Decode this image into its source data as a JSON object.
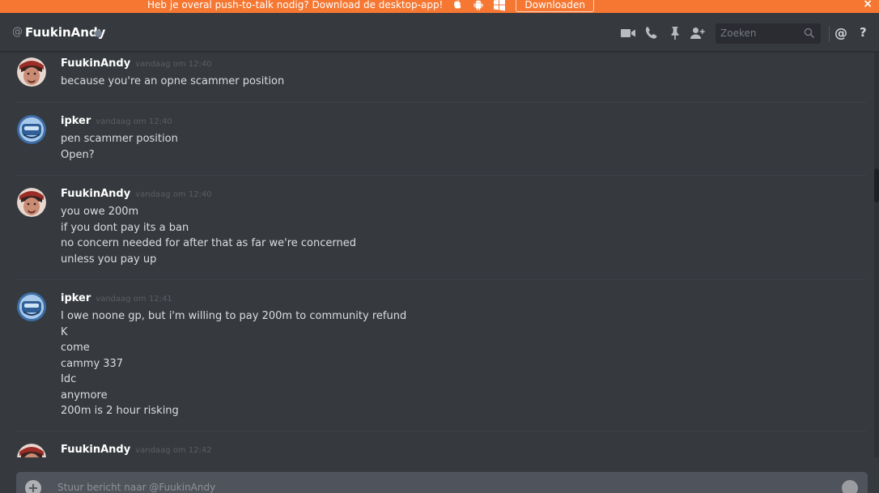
{
  "banner": {
    "text": "Heb je overal push-to-talk nodig? Download de desktop-app!",
    "download_label": "Downloaden",
    "close": "×",
    "icons": [
      "apple-icon",
      "android-icon",
      "windows-icon"
    ],
    "color": "#f57731"
  },
  "header": {
    "at": "@",
    "channel": "FuukinAndy",
    "search_placeholder": "Zoeken",
    "mention": "@",
    "help": "?"
  },
  "messages": [
    {
      "author": "FuukinAndy",
      "time": "vandaag om 12:40",
      "avatar": "avatar-fuukinandy",
      "lines": [
        "because you're an opne scammer position"
      ]
    },
    {
      "author": "ipker",
      "time": "vandaag om 12:40",
      "avatar": "avatar-ipker",
      "lines": [
        "pen scammer position",
        "Open?"
      ]
    },
    {
      "author": "FuukinAndy",
      "time": "vandaag om 12:40",
      "avatar": "avatar-fuukinandy",
      "lines": [
        "you owe 200m",
        "if you dont pay its a ban",
        "no concern needed for after that as far we're concerned",
        "unless you pay up"
      ]
    },
    {
      "author": "ipker",
      "time": "vandaag om 12:41",
      "avatar": "avatar-ipker",
      "lines": [
        "I owe noone gp, but i'm willing to pay 200m to community refund",
        "K",
        "come",
        "cammy 337",
        "Idc",
        "anymore",
        "200m is 2 hour risking"
      ]
    },
    {
      "author": "FuukinAndy",
      "time": "vandaag om 12:42",
      "avatar": "avatar-fuukinandy",
      "lines": []
    }
  ],
  "composer": {
    "placeholder": "Stuur bericht naar @FuukinAndy",
    "plus": "+"
  }
}
